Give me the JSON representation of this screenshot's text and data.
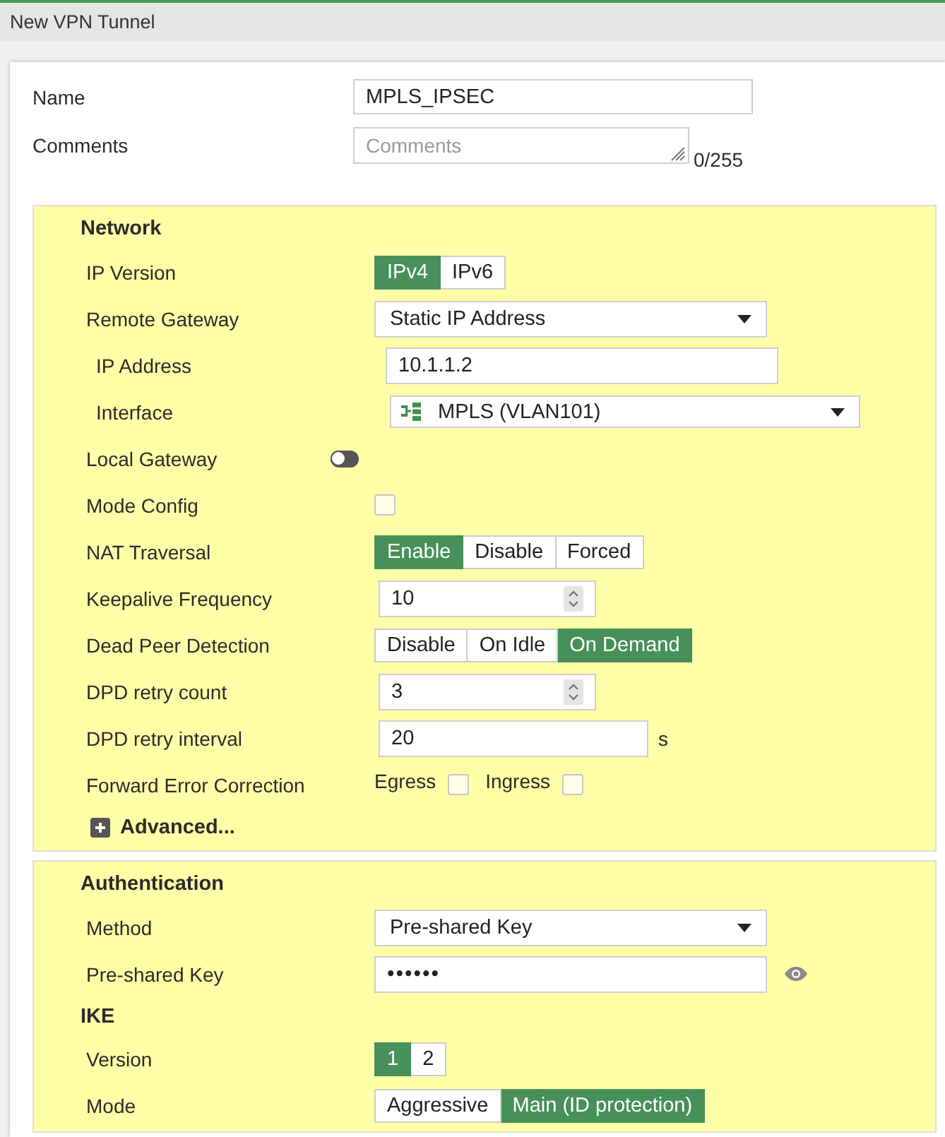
{
  "window": {
    "title": "New VPN Tunnel"
  },
  "general": [
    {
      "kind": "text",
      "label": "Name",
      "value": "MPLS_IPSEC"
    },
    {
      "kind": "textarea",
      "label": "Comments",
      "placeholder": "Comments",
      "counter": "0/255"
    }
  ],
  "panels": [
    {
      "items": [
        {
          "kind": "heading",
          "text": "Network"
        },
        {
          "kind": "segmented",
          "label": "IP Version",
          "options": [
            {
              "label": "IPv4",
              "selected": true
            },
            {
              "label": "IPv6",
              "selected": false
            }
          ]
        },
        {
          "kind": "select",
          "label": "Remote Gateway",
          "value": "Static IP Address",
          "children": [
            {
              "kind": "text",
              "label": "IP Address",
              "value": "10.1.1.2"
            },
            {
              "kind": "interface",
              "label": "Interface",
              "value": "MPLS (VLAN101)"
            }
          ]
        },
        {
          "kind": "toggle",
          "label": "Local Gateway",
          "on": false
        },
        {
          "kind": "checkbox",
          "label": "Mode Config",
          "checked": false
        },
        {
          "kind": "segmented",
          "label": "NAT Traversal",
          "options": [
            {
              "label": "Enable",
              "selected": true
            },
            {
              "label": "Disable",
              "selected": false
            },
            {
              "label": "Forced",
              "selected": false
            }
          ]
        },
        {
          "kind": "number",
          "label": "Keepalive Frequency",
          "value": "10"
        },
        {
          "kind": "segmented",
          "label": "Dead Peer Detection",
          "options": [
            {
              "label": "Disable",
              "selected": false
            },
            {
              "label": "On Idle",
              "selected": false
            },
            {
              "label": "On Demand",
              "selected": true
            }
          ]
        },
        {
          "kind": "number",
          "label": "DPD retry count",
          "value": "3"
        },
        {
          "kind": "text",
          "label": "DPD retry interval",
          "value": "20",
          "unit": "s"
        },
        {
          "kind": "checkgroup",
          "label": "Forward Error Correction",
          "options": [
            {
              "label": "Egress",
              "checked": false
            },
            {
              "label": "Ingress",
              "checked": false
            }
          ]
        },
        {
          "kind": "expander",
          "label": "Advanced...",
          "expanded": false
        }
      ]
    },
    {
      "items": [
        {
          "kind": "heading",
          "text": "Authentication"
        },
        {
          "kind": "select",
          "label": "Method",
          "value": "Pre-shared Key"
        },
        {
          "kind": "password",
          "label": "Pre-shared Key",
          "value": "••••••"
        },
        {
          "kind": "heading",
          "text": "IKE"
        },
        {
          "kind": "segmented",
          "label": "Version",
          "options": [
            {
              "label": "1",
              "selected": true
            },
            {
              "label": "2",
              "selected": false
            }
          ]
        },
        {
          "kind": "segmented",
          "label": "Mode",
          "options": [
            {
              "label": "Aggressive",
              "selected": false
            },
            {
              "label": "Main (ID protection)",
              "selected": true
            }
          ]
        }
      ]
    }
  ]
}
